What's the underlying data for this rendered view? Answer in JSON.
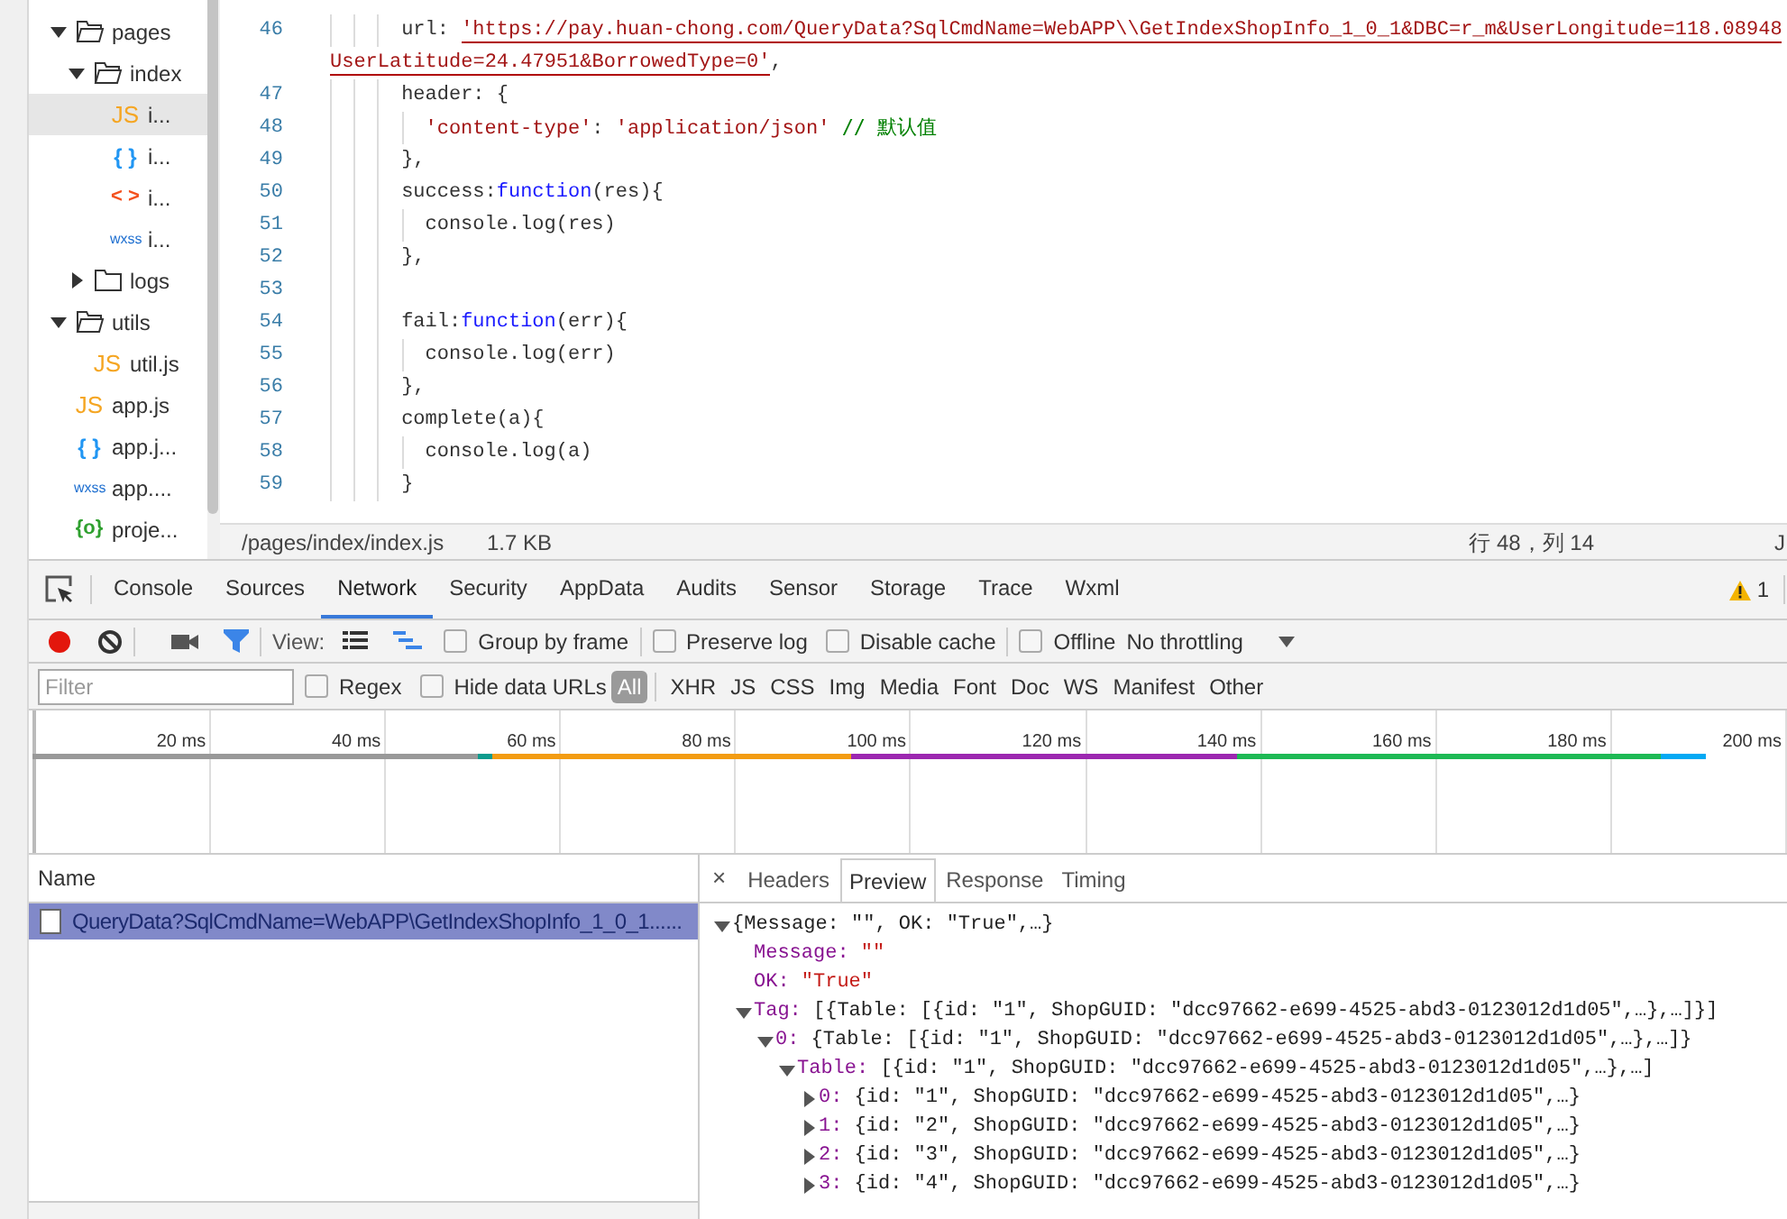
{
  "sidebar": {
    "items": [
      {
        "kind": "folder",
        "label": "pages",
        "expanded": true,
        "selected": false,
        "children": [
          {
            "kind": "folder",
            "label": "index",
            "expanded": true,
            "selected": false,
            "children": [
              {
                "kind": "js",
                "glyph": "JS",
                "label": "i...",
                "selected": true
              },
              {
                "kind": "json",
                "glyph": "{ }",
                "label": "i...",
                "selected": false
              },
              {
                "kind": "wxml",
                "glyph": "< >",
                "label": "i...",
                "selected": false
              },
              {
                "kind": "wxss",
                "glyph": "wxss",
                "label": "i...",
                "selected": false
              }
            ]
          },
          {
            "kind": "folder",
            "label": "logs",
            "expanded": false,
            "selected": false
          }
        ]
      },
      {
        "kind": "folder",
        "label": "utils",
        "expanded": true,
        "selected": false,
        "children": [
          {
            "kind": "js",
            "glyph": "JS",
            "label": "util.js",
            "selected": false
          }
        ]
      },
      {
        "kind": "js",
        "glyph": "JS",
        "label": "app.js",
        "selected": false
      },
      {
        "kind": "json",
        "glyph": "{ }",
        "label": "app.j...",
        "selected": false
      },
      {
        "kind": "wxss",
        "glyph": "wxss",
        "label": "app....",
        "selected": false
      },
      {
        "kind": "config",
        "glyph": "{o}",
        "label": "proje...",
        "selected": false
      }
    ]
  },
  "editor": {
    "lines": [
      {
        "kind": "code",
        "number": "46",
        "tokens": [
          {
            "kind": "plain",
            "text": "url: "
          },
          {
            "kind": "string",
            "text": "'https://pay.huan-chong.com/QueryData?SqlCmdName=WebAPP\\\\GetIndexShopInfo_1_0_1&DBC=r_m&UserLongitude=118.08948",
            "error": true
          }
        ]
      },
      {
        "kind": "wrap",
        "tokens": [
          {
            "kind": "string",
            "text": "UserLatitude=24.47951&BorrowedType=0'",
            "error": true
          },
          {
            "kind": "plain",
            "text": ","
          }
        ]
      },
      {
        "kind": "code",
        "number": "47",
        "tokens": [
          {
            "kind": "plain",
            "text": "header: {"
          }
        ],
        "children": [
          {
            "kind": "code",
            "number": "48",
            "tokens": [
              {
                "kind": "string",
                "text": "'content-type'"
              },
              {
                "kind": "plain",
                "text": ": "
              },
              {
                "kind": "string",
                "text": "'application/json'"
              },
              {
                "kind": "comment",
                "text": "// 默认值"
              }
            ]
          }
        ]
      },
      {
        "kind": "code",
        "number": "49",
        "tokens": [
          {
            "kind": "plain",
            "text": "},"
          }
        ]
      },
      {
        "kind": "code",
        "number": "50",
        "tokens": [
          {
            "kind": "plain",
            "text": "success:"
          },
          {
            "kind": "keyword",
            "text": "function"
          },
          {
            "kind": "plain",
            "text": "(res){"
          }
        ],
        "children": [
          {
            "kind": "code",
            "number": "51",
            "tokens": [
              {
                "kind": "plain",
                "text": "console.log(res)"
              }
            ]
          }
        ]
      },
      {
        "kind": "code",
        "number": "52",
        "tokens": [
          {
            "kind": "plain",
            "text": "},"
          }
        ]
      },
      {
        "kind": "code",
        "number": "53"
      },
      {
        "kind": "code",
        "number": "54",
        "tokens": [
          {
            "kind": "plain",
            "text": "fail:"
          },
          {
            "kind": "keyword",
            "text": "function"
          },
          {
            "kind": "plain",
            "text": "(err){"
          }
        ],
        "children": [
          {
            "kind": "code",
            "number": "55",
            "tokens": [
              {
                "kind": "plain",
                "text": "console.log(err)"
              }
            ]
          }
        ]
      },
      {
        "kind": "code",
        "number": "56",
        "tokens": [
          {
            "kind": "plain",
            "text": "},"
          }
        ]
      },
      {
        "kind": "code",
        "number": "57",
        "tokens": [
          {
            "kind": "plain",
            "text": "complete(a){"
          }
        ],
        "children": [
          {
            "kind": "code",
            "number": "58",
            "tokens": [
              {
                "kind": "plain",
                "text": "console.log(a)"
              }
            ]
          }
        ]
      },
      {
        "kind": "code",
        "number": "59",
        "tokens": [
          {
            "kind": "plain",
            "text": "}"
          }
        ]
      }
    ],
    "status_bar": {
      "path": "/pages/index/index.js",
      "size": "1.7 KB",
      "cursor": "行 48，列 14",
      "language": "J"
    }
  },
  "devtools": {
    "tabs": [
      {
        "label": "Console",
        "selected": false
      },
      {
        "label": "Sources",
        "selected": false
      },
      {
        "label": "Network",
        "selected": true
      },
      {
        "label": "Security",
        "selected": false
      },
      {
        "label": "AppData",
        "selected": false
      },
      {
        "label": "Audits",
        "selected": false
      },
      {
        "label": "Sensor",
        "selected": false
      },
      {
        "label": "Storage",
        "selected": false
      },
      {
        "label": "Trace",
        "selected": false
      },
      {
        "label": "Wxml",
        "selected": false
      }
    ],
    "warnings": "1",
    "toolbar": {
      "recording": true,
      "filter_active": true,
      "view_label": "View:",
      "view_modes": [
        {
          "kind": "list",
          "selected": false
        },
        {
          "kind": "waterfall",
          "selected": true
        }
      ],
      "checkboxes": [
        {
          "label": "Group by frame",
          "checked": false
        },
        {
          "label": "Preserve log",
          "checked": false
        },
        {
          "label": "Disable cache",
          "checked": false
        }
      ],
      "offline": {
        "label": "Offline",
        "checked": false
      },
      "throttling": "No throttling"
    },
    "filter": {
      "placeholder": "Filter",
      "regex": {
        "label": "Regex",
        "checked": false
      },
      "hide_data_urls": {
        "label": "Hide data URLs",
        "checked": false
      },
      "types": [
        {
          "label": "All",
          "selected": true
        },
        {
          "label": "XHR",
          "selected": false
        },
        {
          "label": "JS",
          "selected": false
        },
        {
          "label": "CSS",
          "selected": false
        },
        {
          "label": "Img",
          "selected": false
        },
        {
          "label": "Media",
          "selected": false
        },
        {
          "label": "Font",
          "selected": false
        },
        {
          "label": "Doc",
          "selected": false
        },
        {
          "label": "WS",
          "selected": false
        },
        {
          "label": "Manifest",
          "selected": false
        },
        {
          "label": "Other",
          "selected": false
        }
      ]
    },
    "overview": {
      "ticks": [
        "20 ms",
        "40 ms",
        "60 ms",
        "80 ms",
        "100 ms",
        "120 ms",
        "140 ms",
        "160 ms",
        "180 ms",
        "200 ms"
      ]
    },
    "requests": {
      "column": "Name",
      "rows": [
        {
          "name": "QueryData?SqlCmdName=WebAPP\\GetIndexShopInfo_1_0_1......",
          "selected": true
        }
      ]
    },
    "detail": {
      "close": "×",
      "tabs": [
        {
          "label": "Headers",
          "selected": false
        },
        {
          "label": "Preview",
          "selected": true
        },
        {
          "label": "Response",
          "selected": false
        },
        {
          "label": "Timing",
          "selected": false
        }
      ],
      "preview": [
        {
          "summary": "{Message: \"\", OK: \"True\",…}",
          "expanded": true,
          "children": [
            {
              "key": "Message:",
              "value": "\"\""
            },
            {
              "key": "OK:",
              "value": "\"True\""
            },
            {
              "key": "Tag:",
              "summary": "[{Table: [{id: \"1\", ShopGUID: \"dcc97662-e699-4525-abd3-0123012d1d05\",…},…]}]",
              "expanded": true,
              "children": [
                {
                  "key": "0:",
                  "summary": "{Table: [{id: \"1\", ShopGUID: \"dcc97662-e699-4525-abd3-0123012d1d05\",…},…]}",
                  "expanded": true,
                  "children": [
                    {
                      "key": "Table:",
                      "summary": "[{id: \"1\", ShopGUID: \"dcc97662-e699-4525-abd3-0123012d1d05\",…},…]",
                      "expanded": true,
                      "children": [
                        {
                          "key": "0:",
                          "summary": "{id: \"1\", ShopGUID: \"dcc97662-e699-4525-abd3-0123012d1d05\",…}",
                          "expanded": false
                        },
                        {
                          "key": "1:",
                          "summary": "{id: \"2\", ShopGUID: \"dcc97662-e699-4525-abd3-0123012d1d05\",…}",
                          "expanded": false
                        },
                        {
                          "key": "2:",
                          "summary": "{id: \"3\", ShopGUID: \"dcc97662-e699-4525-abd3-0123012d1d05\",…}",
                          "expanded": false
                        },
                        {
                          "key": "3:",
                          "summary": "{id: \"4\", ShopGUID: \"dcc97662-e699-4525-abd3-0123012d1d05\",…}",
                          "expanded": false
                        }
                      ]
                    }
                  ]
                }
              ]
            }
          ]
        }
      ]
    }
  }
}
